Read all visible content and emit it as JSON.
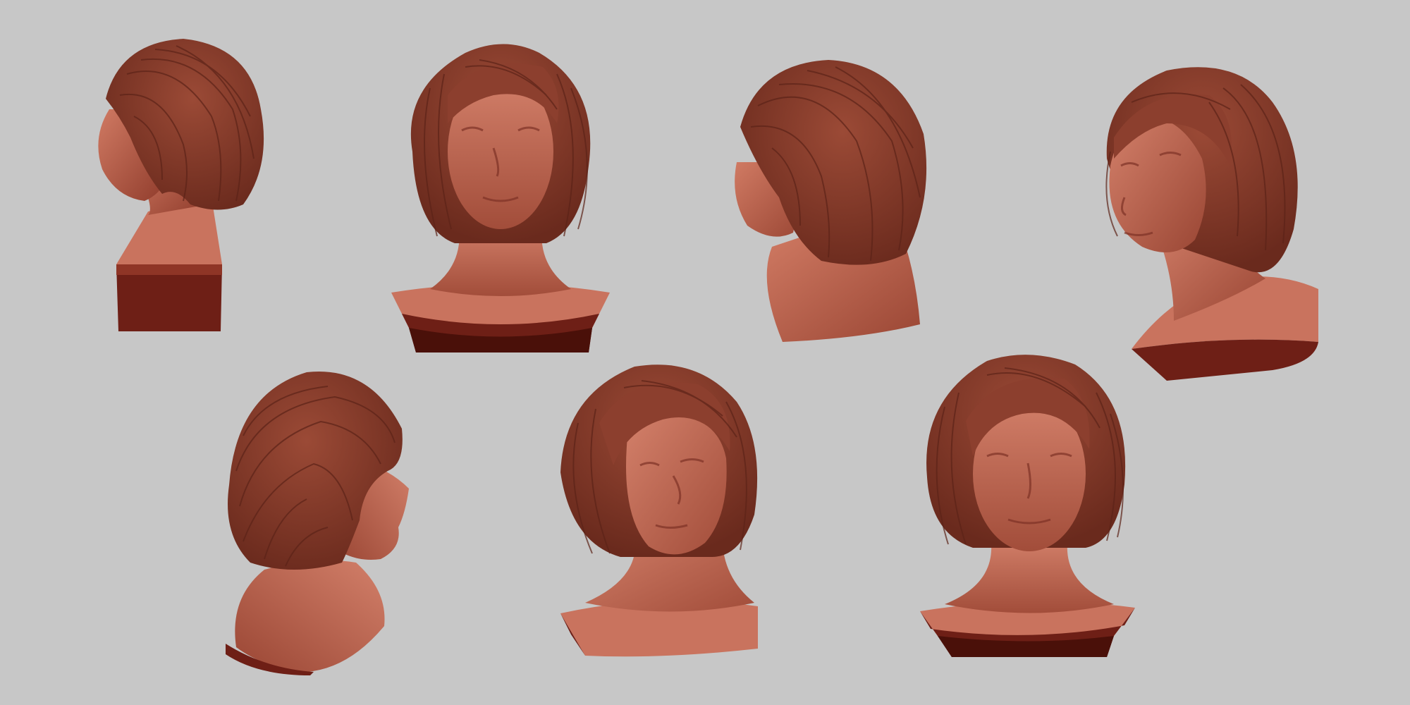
{
  "scene": {
    "background_color": "#c7c7c7",
    "subject": "clay-bust",
    "clay_colors": {
      "skin_light": "#c9735e",
      "skin_mid": "#b05a46",
      "skin_shadow": "#7e3226",
      "hair": "#8c3f2e",
      "hair_strand": "#5c2318",
      "base_side": "#6e1f16",
      "base_deep": "#4a1009"
    },
    "views": [
      {
        "id": "back-left-profile"
      },
      {
        "id": "front-up-tilt"
      },
      {
        "id": "back-left-three-quarter"
      },
      {
        "id": "left-three-quarter-up"
      },
      {
        "id": "right-profile"
      },
      {
        "id": "front-right-three-quarter"
      },
      {
        "id": "front"
      }
    ]
  }
}
